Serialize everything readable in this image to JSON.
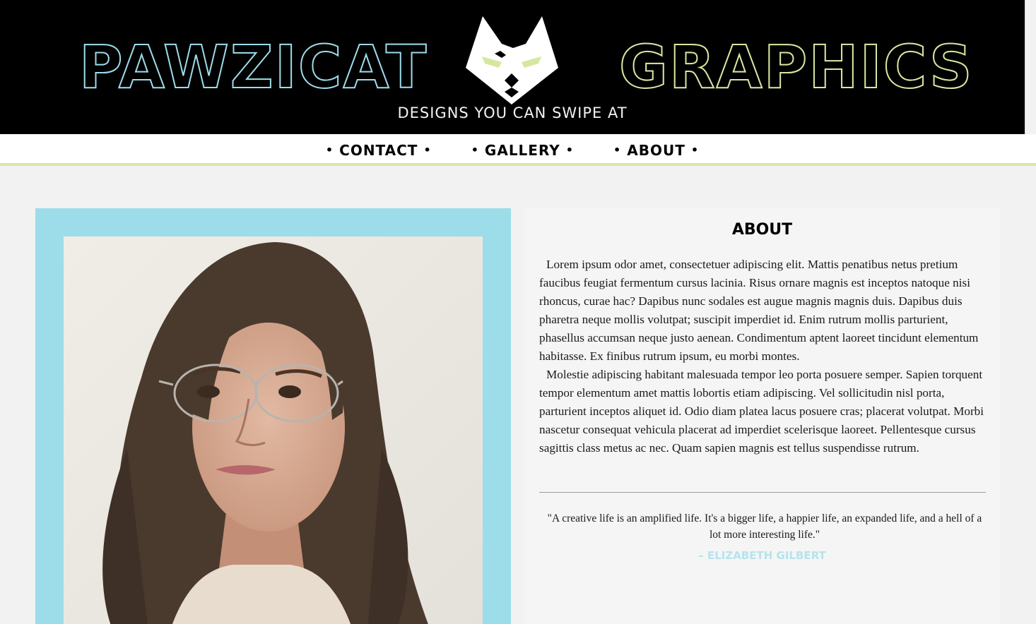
{
  "header": {
    "brand_left": "PAWZICAT",
    "brand_right": "GRAPHICS",
    "tagline": "DESIGNS YOU CAN SWIPE AT",
    "logo_icon": "cat-head-logo-icon"
  },
  "nav": {
    "items": [
      {
        "label": "CONTACT"
      },
      {
        "label": "GALLERY"
      },
      {
        "label": "ABOUT"
      }
    ],
    "bullet": "•"
  },
  "about": {
    "title": "ABOUT",
    "paragraphs": [
      "Lorem ipsum odor amet, consectetuer adipiscing elit. Mattis penatibus netus pretium faucibus feugiat fermentum cursus lacinia. Risus ornare magnis est inceptos natoque nisi rhoncus, curae hac? Dapibus nunc sodales est augue magnis magnis duis. Dapibus duis pharetra neque mollis volutpat; suscipit imperdiet id. Enim rutrum mollis parturient, phasellus accumsan neque justo aenean. Condimentum aptent laoreet tincidunt elementum habitasse. Ex finibus rutrum ipsum, eu morbi montes.",
      "Molestie adipiscing habitant malesuada tempor leo porta posuere semper. Sapien torquent tempor elementum amet mattis lobortis etiam adipiscing. Vel sollicitudin nisl porta, parturient inceptos aliquet id. Odio diam platea lacus posuere cras; placerat volutpat. Morbi nascetur consequat vehicula placerat ad imperdiet scelerisque laoreet. Pellentesque cursus sagittis class metus ac nec. Quam sapien magnis est tellus suspendisse rutrum."
    ],
    "quote": "\"A creative life is an amplified life. It's a bigger life, a happier life, an expanded life, and a hell of a lot more interesting life.\"",
    "quote_author": "– ELIZABETH GILBERT"
  },
  "colors": {
    "accent_blue": "#9ddde9",
    "accent_green": "#d6e8a0",
    "header_bg": "#000000"
  }
}
